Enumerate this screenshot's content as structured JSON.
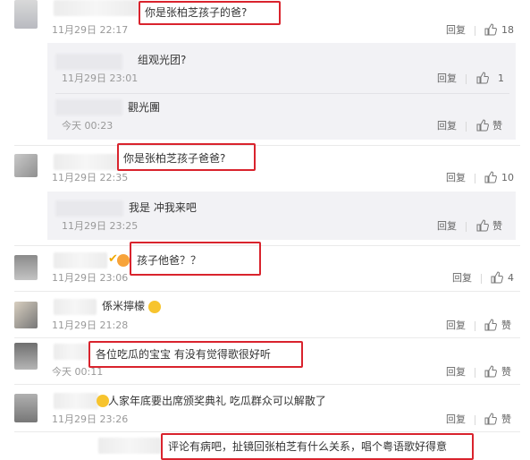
{
  "comments": [
    {
      "text": "你是张柏芝孩子的爸?",
      "time": "11月29日 22:17",
      "reply": "回复",
      "likes": "18"
    },
    {
      "text": "组观光团?",
      "time": "11月29日 23:01",
      "reply": "回复",
      "likes": "1"
    },
    {
      "text": "觀光團",
      "time": "今天 00:23",
      "reply": "回复",
      "likes": "赞"
    },
    {
      "text": "你是张柏芝孩子爸爸?",
      "time": "11月29日 22:35",
      "reply": "回复",
      "likes": "10"
    },
    {
      "text": "我是 冲我来吧",
      "time": "11月29日 23:25",
      "reply": "回复",
      "likes": "赞"
    },
    {
      "text": "孩子他爸？？",
      "time": "11月29日 23:06",
      "reply": "回复",
      "likes": "4"
    },
    {
      "text": "係米擰檬",
      "time": "11月29日 21:28",
      "reply": "回复",
      "likes": "赞"
    },
    {
      "text": "各位吃瓜的宝宝 有没有觉得歌很好听",
      "time": "今天 00:11",
      "reply": "回复",
      "likes": "赞"
    },
    {
      "text": "人家年底要出席颁奖典礼 吃瓜群众可以解散了",
      "time": "11月29日 23:26",
      "reply": "回复",
      "likes": "赞"
    },
    {
      "text": "评论有病吧，扯镜回张柏芝有什么关系，唱个粤语歌好得意"
    }
  ],
  "colors": {
    "accent": "#d9232d",
    "reply_bg": "#f2f2f5",
    "meta": "#999999"
  }
}
